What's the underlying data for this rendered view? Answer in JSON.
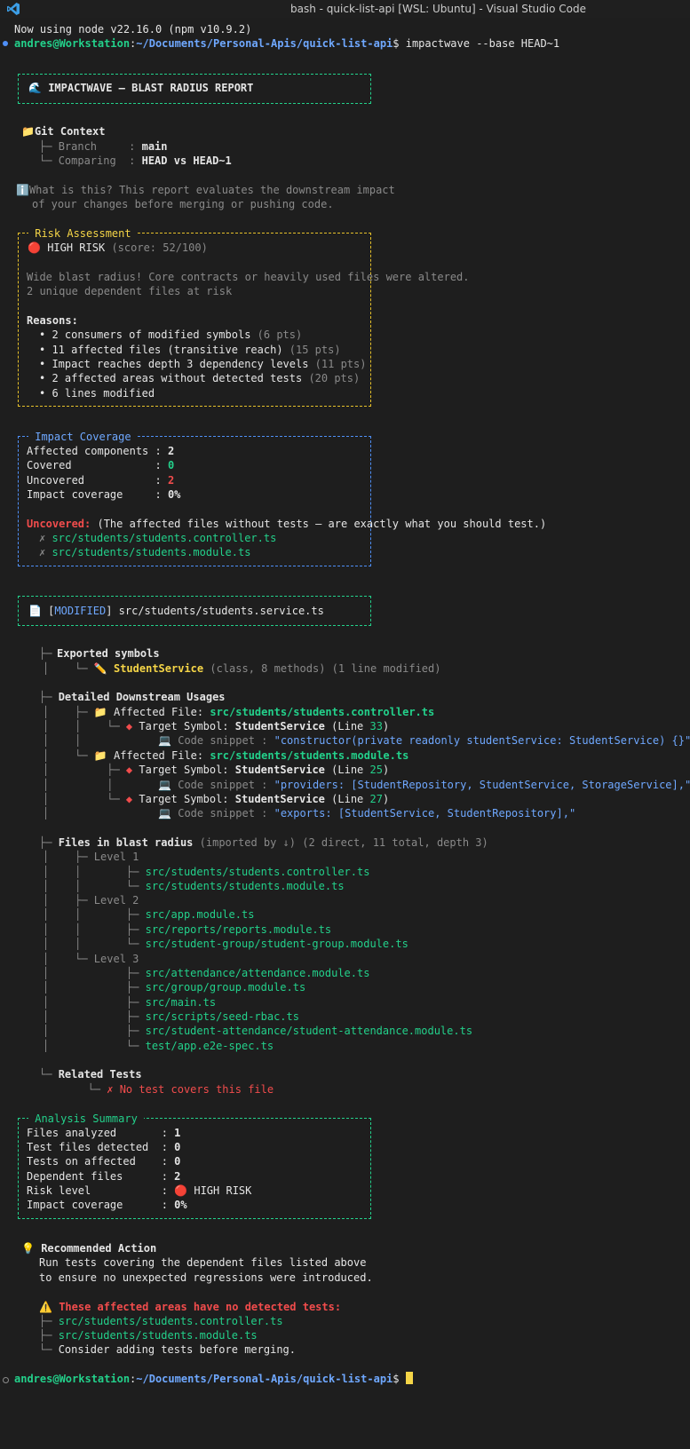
{
  "window": {
    "title": "bash - quick-list-api [WSL: Ubuntu] - Visual Studio Code"
  },
  "prompt": {
    "user": "andres@Workstation",
    "path": "~/Documents/Personal-Apis/quick-list-api",
    "symbol": "$",
    "command": "impactwave --base HEAD~1"
  },
  "node_msg": "Now using node v22.16.0 (npm v10.9.2)",
  "header": {
    "icon": "🌊",
    "title": "IMPACTWAVE — BLAST RADIUS REPORT"
  },
  "git": {
    "icon": "📁",
    "title": "Git Context",
    "branch_label": "Branch     : ",
    "branch": "main",
    "compare_label": "Comparing  : ",
    "compare": "HEAD vs HEAD~1"
  },
  "info": {
    "icon": "ℹ️",
    "line1": "What is this? This report evaluates the downstream impact",
    "line2": "of your changes before merging or pushing code."
  },
  "risk": {
    "title": " Risk Assessment ",
    "icon": "🔴",
    "level": "HIGH RISK",
    "score": "(score: 52/100)",
    "desc1": "Wide blast radius! Core contracts or heavily used files were altered.",
    "desc2": "2 unique dependent files at risk",
    "reasons_label": "Reasons:",
    "reasons": [
      {
        "text": "2 consumers of modified symbols ",
        "pts": "(6 pts)"
      },
      {
        "text": "11 affected files (transitive reach) ",
        "pts": "(15 pts)"
      },
      {
        "text": "Impact reaches depth 3 dependency levels ",
        "pts": "(11 pts)"
      },
      {
        "text": "2 affected areas without detected tests ",
        "pts": "(20 pts)"
      },
      {
        "text": "6 lines modified",
        "pts": ""
      }
    ]
  },
  "coverage": {
    "title": " Impact Coverage ",
    "rows": [
      {
        "label": "Affected components : ",
        "value": "2"
      },
      {
        "label": "Covered             : ",
        "value": "0"
      },
      {
        "label": "Uncovered           : ",
        "value": "2"
      },
      {
        "label": "Impact coverage     : ",
        "value": "0%"
      }
    ],
    "uncovered_label": "Uncovered:",
    "uncovered_note": " (The affected files without tests — are exactly what you should test.)",
    "files": [
      "src/students/students.controller.ts",
      "src/students/students.module.ts"
    ]
  },
  "modified": {
    "icon": "📄",
    "tag": "MODIFIED",
    "file": "src/students/students.service.ts"
  },
  "exported": {
    "title": "Exported symbols",
    "icon": "✏️",
    "symbol": "StudentService",
    "meta": "(class, 8 methods) (1 line modified)"
  },
  "usages": {
    "title": "Detailed Downstream Usages",
    "files": [
      {
        "label": "Affected File: ",
        "path": "src/students/students.controller.ts",
        "targets": [
          {
            "symbol": "StudentService",
            "line": "33",
            "snippet": "\"constructor(private readonly studentService: StudentService) {}\""
          }
        ]
      },
      {
        "label": "Affected File: ",
        "path": "src/students/students.module.ts",
        "targets": [
          {
            "symbol": "StudentService",
            "line": "25",
            "snippet": "\"providers: [StudentRepository, StudentService, StorageService],\""
          },
          {
            "symbol": "StudentService",
            "line": "27",
            "snippet": "\"exports: [StudentService, StudentRepository],\""
          }
        ]
      }
    ]
  },
  "blast": {
    "title": "Files in blast radius",
    "meta": "(imported by ↓) (2 direct, 11 total, depth 3)",
    "levels": [
      {
        "name": "Level 1",
        "files": [
          "src/students/students.controller.ts",
          "src/students/students.module.ts"
        ]
      },
      {
        "name": "Level 2",
        "files": [
          "src/app.module.ts",
          "src/reports/reports.module.ts",
          "src/student-group/student-group.module.ts"
        ]
      },
      {
        "name": "Level 3",
        "files": [
          "src/attendance/attendance.module.ts",
          "src/group/group.module.ts",
          "src/main.ts",
          "src/scripts/seed-rbac.ts",
          "src/student-attendance/student-attendance.module.ts",
          "test/app.e2e-spec.ts"
        ]
      }
    ]
  },
  "related": {
    "title": "Related Tests",
    "message": "No test covers this file"
  },
  "summary": {
    "title": " Analysis Summary ",
    "rows": [
      {
        "label": "Files analyzed       : ",
        "value": "1"
      },
      {
        "label": "Test files detected  : ",
        "value": "0"
      },
      {
        "label": "Tests on affected    : ",
        "value": "0"
      },
      {
        "label": "Dependent files      : ",
        "value": "2"
      },
      {
        "label": "Risk level           : ",
        "value": "HIGH RISK"
      },
      {
        "label": "Impact coverage      : ",
        "value": "0%"
      }
    ]
  },
  "action": {
    "icon": "💡",
    "title": "Recommended Action",
    "line1": "Run tests covering the dependent files listed above",
    "line2": "to ensure no unexpected regressions were introduced.",
    "warn_icon": "⚠️",
    "warn": "These affected areas have no detected tests:",
    "files": [
      "src/students/students.controller.ts",
      "src/students/students.module.ts"
    ],
    "note": "Consider adding tests before merging."
  },
  "colors": {
    "green": "#23d18b",
    "cyan": "#29b8db",
    "blue": "#6fa8ff",
    "yellow": "#f5d547",
    "red": "#f14c4c",
    "bg": "#1e1e1e"
  }
}
